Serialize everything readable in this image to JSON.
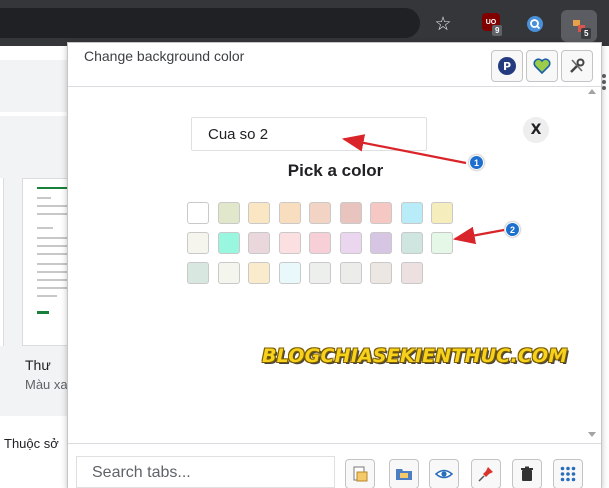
{
  "browser": {
    "extensions": [
      {
        "name": "ublock-origin",
        "badge": "9"
      },
      {
        "name": "search-extension"
      },
      {
        "name": "tab-manager",
        "badge": "5"
      }
    ]
  },
  "background_page": {
    "doc_title": "Thư",
    "doc_subtitle": "Màu xa",
    "bottom_text": "Thuộc sở"
  },
  "popup": {
    "header_title": "Change background color",
    "header_buttons": [
      "paypal-icon",
      "heart-icon",
      "tools-icon"
    ],
    "tab_name_value": "Cua so 2",
    "close_label": "X",
    "pick_title": "Pick a color",
    "colors": [
      [
        "#ffffff",
        "#e1e7cb",
        "#fbe6c4",
        "#f9ddbf",
        "#f3d3c3",
        "#e9c3bd",
        "#f6c8c3",
        "#b9ecf9",
        "#f6edbc"
      ],
      [
        "#f6f5ed",
        "#99f7df",
        "#e9d7dc",
        "#fbdfe1",
        "#f7cfd6",
        "#ead6ee",
        "#d7c5e4",
        "#cfe5df",
        "#e5f7e6"
      ],
      [
        "#d8e7e0",
        "#f4f6ee",
        "#fbebcd",
        "#e9f9fb",
        "#edefec",
        "#ececea",
        "#ece7e2",
        "#ede0e1"
      ]
    ],
    "annotations": [
      "1",
      "2"
    ],
    "watermark": "BLOGCHIASEKIENTHUC.COM",
    "search_placeholder": "Search tabs...",
    "footer_buttons": [
      "save-session-icon",
      "open-folder-icon",
      "eye-icon",
      "pin-icon",
      "trash-icon",
      "grid-icon"
    ]
  }
}
